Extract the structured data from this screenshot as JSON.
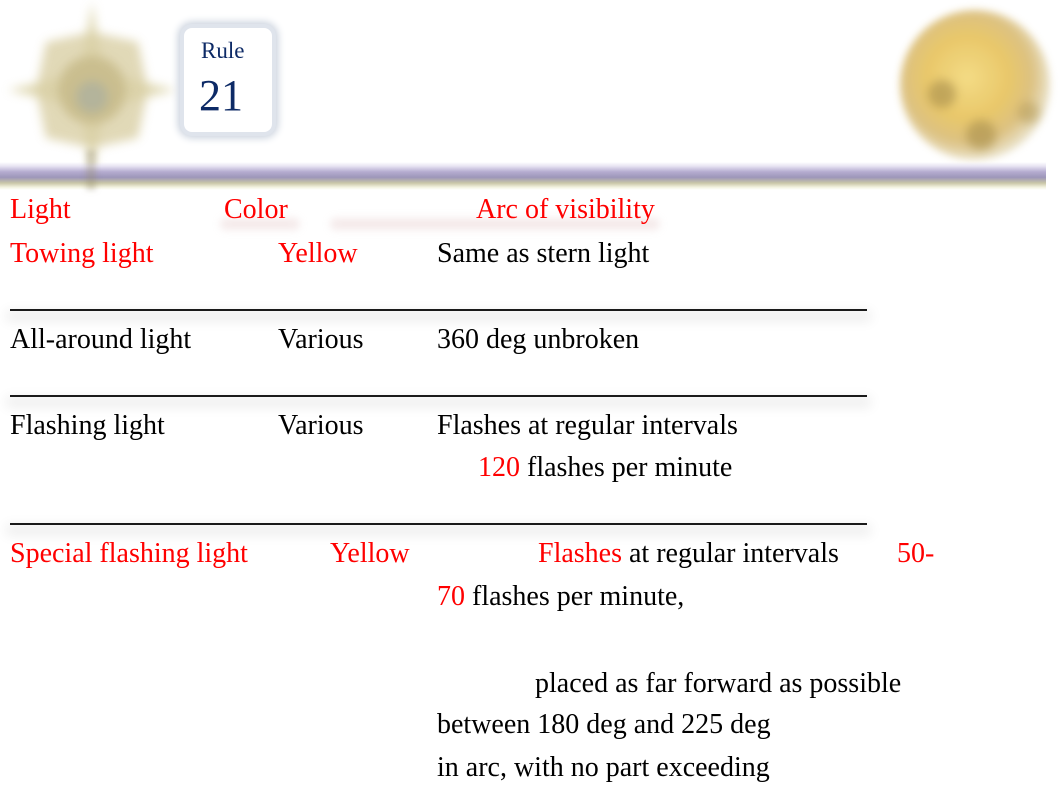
{
  "header": {
    "rule_label": "Rule",
    "rule_number": "21",
    "decorations": [
      "compass-rose-icon",
      "globe-icon"
    ]
  },
  "colors": {
    "accent": "#ff0000",
    "rule_text": "#0d2a66",
    "body_text": "#000000"
  },
  "table": {
    "columns": [
      "Light",
      "Color",
      "Arc of visibility"
    ],
    "rows": [
      {
        "light": "Towing light",
        "color": "Yellow",
        "arc": [
          "Same as stern light"
        ]
      },
      {
        "light": "All-around light",
        "color": "Various",
        "arc": [
          "360 deg unbroken"
        ]
      },
      {
        "light": "Flashing light",
        "color": "Various",
        "arc": [
          "Flashes at regular intervals"
        ],
        "arc_line2_num": "120",
        "arc_line2_rest": " flashes per minute"
      },
      {
        "light": "Special flashing light",
        "color": "Yellow",
        "arc_line1_red": "Flashes",
        "arc_line1_rest": " at regular intervals",
        "arc_line1_num": "50-",
        "arc_line2_num": "70",
        "arc_line2_rest": " flashes per minute,",
        "arc_extra": [
          "placed as far forward as possible",
          "between 180 deg and 225 deg",
          "in arc, with no part exceeding"
        ]
      }
    ],
    "separator": "________________________________________________"
  }
}
